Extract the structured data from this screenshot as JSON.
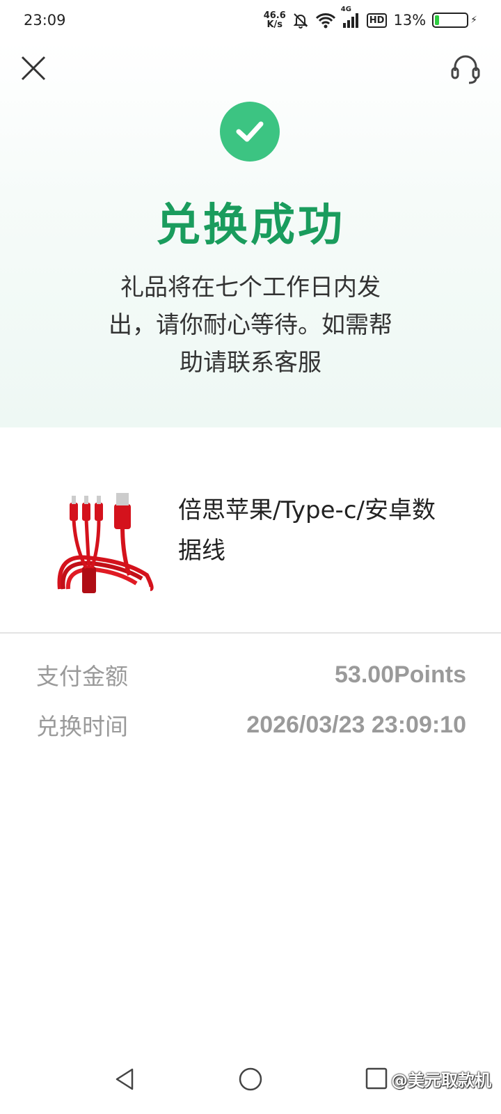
{
  "status_bar": {
    "time": "23:09",
    "net_speed_value": "46.6",
    "net_speed_unit": "K/s",
    "network_type": "4G",
    "hd_label": "HD",
    "battery_percent_label": "13%",
    "battery_level": 0.13
  },
  "header": {
    "close_icon": "close-icon",
    "support_icon": "headset-icon"
  },
  "result": {
    "title": "兑换成功",
    "description": "礼品将在七个工作日内发出，请你耐心等待。如需帮助请联系客服",
    "success_color": "#3cc482",
    "title_color": "#1a9c5d"
  },
  "product": {
    "name": "倍思苹果/Type-c/安卓数据线",
    "image_icon": "red-charging-cable"
  },
  "details": {
    "amount_label": "支付金额",
    "amount_value": "53.00Points",
    "time_label": "兑换时间",
    "time_value": "2026/03/23 23:09:10"
  },
  "nav": {
    "back_icon": "back-triangle-icon",
    "home_icon": "home-circle-icon",
    "recent_icon": "recent-apps-icon"
  },
  "watermark": "@美元取款机"
}
